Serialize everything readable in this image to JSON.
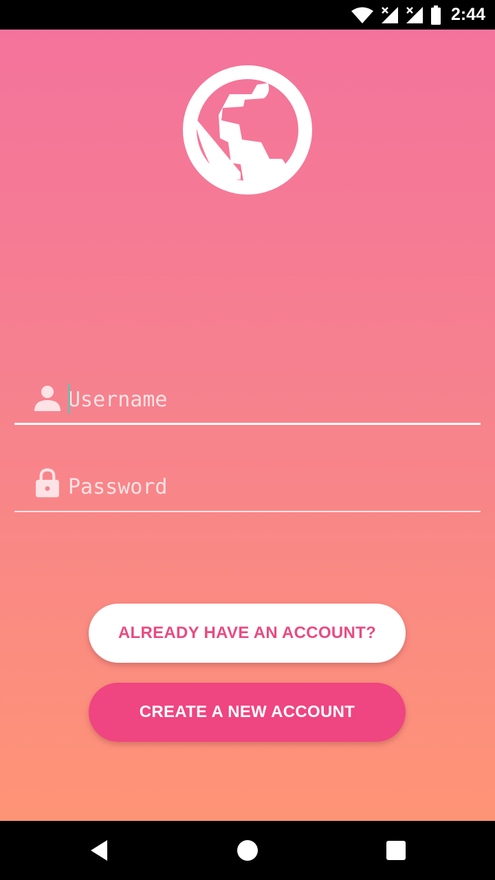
{
  "status_bar": {
    "time": "2:44",
    "icons": [
      "wifi-icon",
      "signal-x-icon",
      "signal-x-icon",
      "battery-icon"
    ]
  },
  "logo": {
    "icon": "globe-icon"
  },
  "form": {
    "username": {
      "placeholder": "Username",
      "value": "",
      "icon": "person-icon"
    },
    "password": {
      "placeholder": "Password",
      "value": "",
      "icon": "lock-icon"
    }
  },
  "buttons": {
    "login_label": "ALREADY HAVE AN ACCOUNT?",
    "create_label": "CREATE A NEW ACCOUNT"
  },
  "nav_bar": {
    "icons": [
      "back-icon",
      "home-icon",
      "recents-icon"
    ]
  },
  "colors": {
    "gradient_top": "#f4739c",
    "gradient_bottom": "#fe9476",
    "accent_pink": "#ef4580",
    "white": "#ffffff"
  }
}
